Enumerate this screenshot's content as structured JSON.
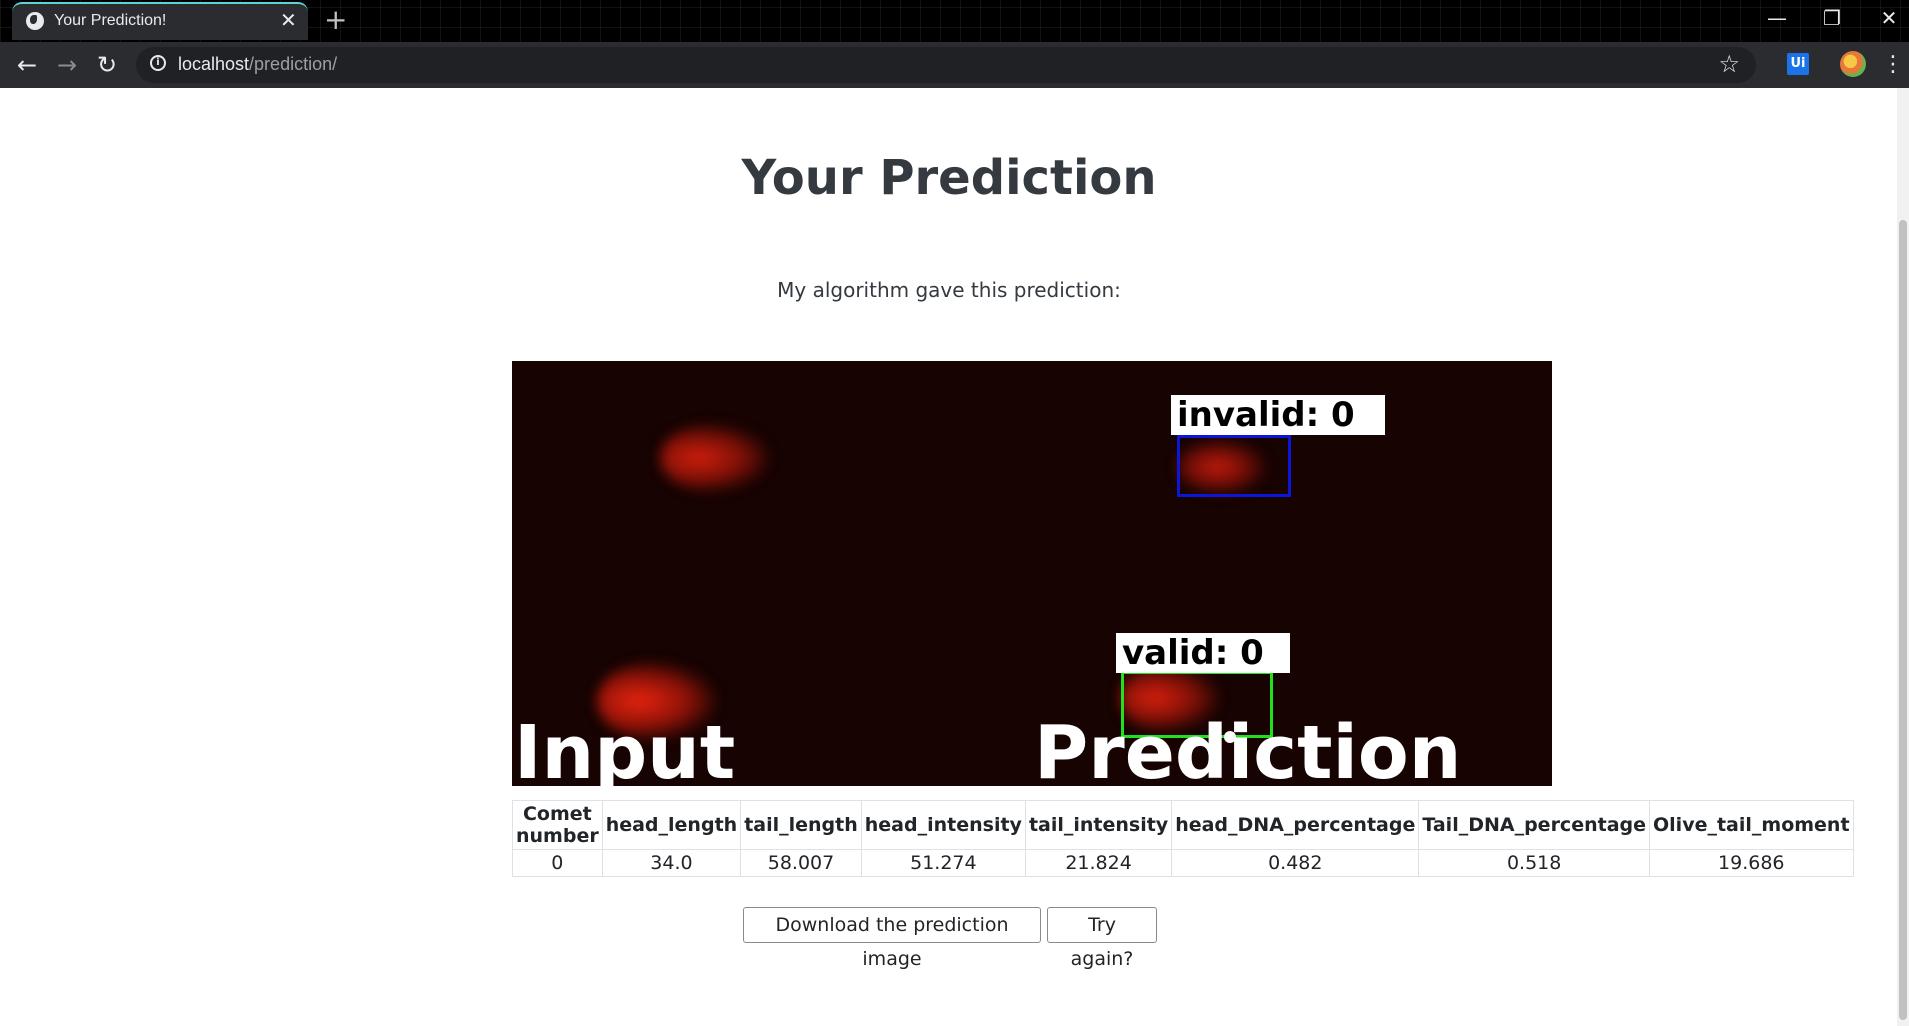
{
  "browser": {
    "tab_title": "Your Prediction!",
    "tab_close": "✕",
    "new_tab": "+",
    "url_host": "localhost",
    "url_path": "/prediction/",
    "ext_label": "Ui",
    "window_controls": {
      "minimize": "—",
      "restore": "❐",
      "close": "✕"
    }
  },
  "page": {
    "title": "Your Prediction",
    "lead": "My algorithm gave this prediction:",
    "image": {
      "invalid_label": "invalid: 0",
      "valid_label": "valid: 0",
      "input_caption": "Input",
      "prediction_caption": "Prediction",
      "colors": {
        "invalid_box": "#0b16d8",
        "valid_box": "#20e020",
        "background": "#160302",
        "comet": "#c41a0c"
      }
    },
    "table": {
      "headers": [
        "Comet number",
        "head_length",
        "tail_length",
        "head_intensity",
        "tail_intensity",
        "head_DNA_percentage",
        "Tail_DNA_percentage",
        "Olive_tail_moment"
      ],
      "rows": [
        [
          "0",
          "34.0",
          "58.007",
          "51.274",
          "21.824",
          "0.482",
          "0.518",
          "19.686"
        ]
      ]
    },
    "buttons": {
      "download": "Download the prediction image",
      "retry": "Try again?"
    }
  }
}
